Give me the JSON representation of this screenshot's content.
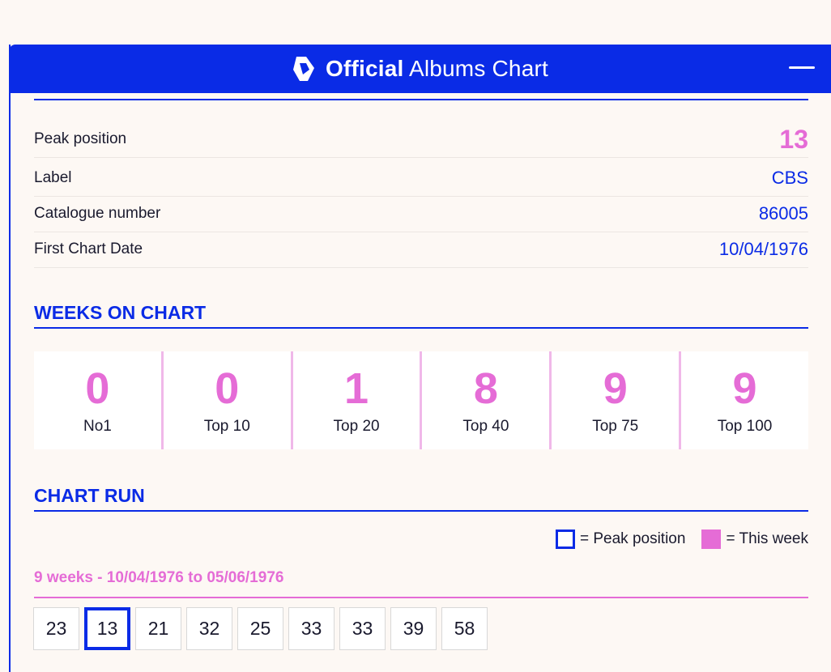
{
  "header": {
    "title_bold": "Official",
    "title_rest": "Albums Chart"
  },
  "details": [
    {
      "label": "Peak position",
      "value": "13"
    },
    {
      "label": "Label",
      "value": "CBS"
    },
    {
      "label": "Catalogue number",
      "value": "86005"
    },
    {
      "label": "First Chart Date",
      "value": "10/04/1976"
    }
  ],
  "weeks_on_chart": {
    "title": "WEEKS ON CHART",
    "items": [
      {
        "value": "0",
        "label": "No1"
      },
      {
        "value": "0",
        "label": "Top 10"
      },
      {
        "value": "1",
        "label": "Top 20"
      },
      {
        "value": "8",
        "label": "Top 40"
      },
      {
        "value": "9",
        "label": "Top 75"
      },
      {
        "value": "9",
        "label": "Top 100"
      }
    ]
  },
  "chart_run": {
    "title": "CHART RUN",
    "legend_peak": "= Peak position",
    "legend_this_week": "= This week",
    "range": "9 weeks - 10/04/1976 to 05/06/1976",
    "positions": [
      "23",
      "13",
      "21",
      "32",
      "25",
      "33",
      "33",
      "39",
      "58"
    ],
    "peak_index": 1
  },
  "colors": {
    "brand_blue": "#0a2be6",
    "accent_pink": "#e56cd6"
  }
}
